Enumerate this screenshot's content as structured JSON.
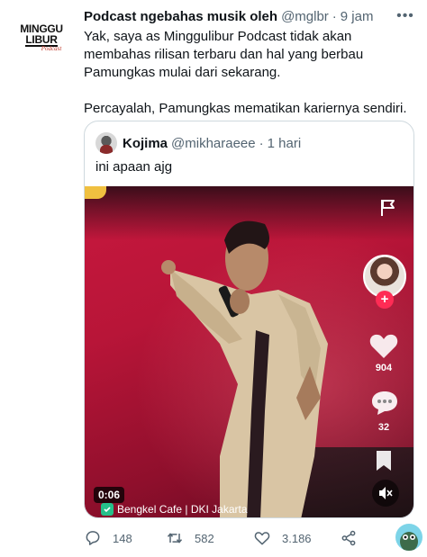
{
  "tweet": {
    "account_logo": {
      "line1": "MINGGU",
      "line2": "LIBUR",
      "line3": "Podcast"
    },
    "author_name": "Podcast ngebahas musik oleh",
    "handle": "@mglbr",
    "separator": "·",
    "time": "9 jam",
    "more_label": "•••",
    "paragraphs": [
      "Yak, saya as Minggulibur Podcast tidak akan membahas rilisan terbaru dan hal yang berbau Pamungkas mulai dari sekarang.",
      "Percayalah, Pamungkas mematikan kariernya sendiri."
    ]
  },
  "quote": {
    "author_name": "Kojima",
    "handle": "@mikharaeee",
    "separator": "·",
    "time": "1 hari",
    "text": "ini apaan ajg",
    "video": {
      "duration": "0:06",
      "location": "Bengkel Cafe | DKI Jakarta",
      "likes": "904",
      "comments": "32",
      "follow_symbol": "+"
    }
  },
  "actions": {
    "replies": "148",
    "retweets": "582",
    "likes": "3.186"
  },
  "colors": {
    "text_primary": "#0f1419",
    "text_secondary": "#536471",
    "border": "#cfd9de",
    "stage_red": "#c8183e",
    "tiktok_red": "#fe2c55"
  },
  "icons": [
    "more-icon",
    "reply-icon",
    "retweet-icon",
    "like-icon",
    "share-icon",
    "flag-icon",
    "heart-icon",
    "comment-icon",
    "bookmark-icon",
    "mute-icon",
    "location-icon"
  ]
}
